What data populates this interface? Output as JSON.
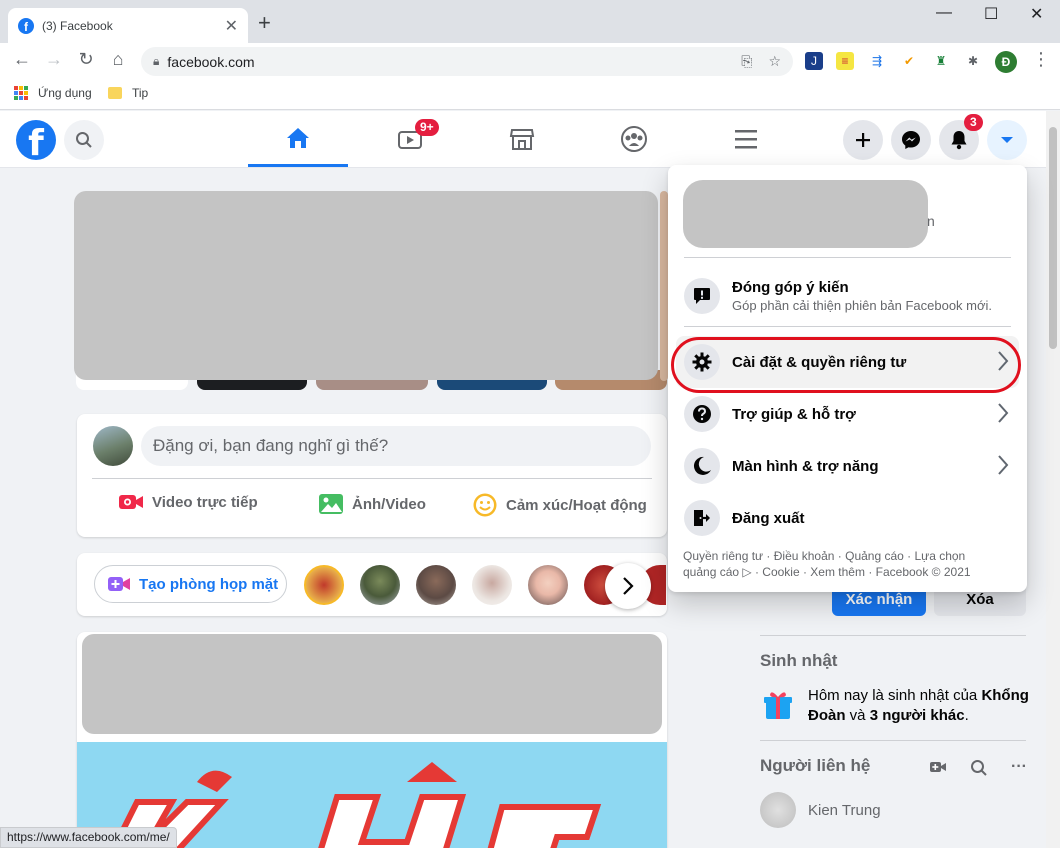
{
  "browser": {
    "tab_title": "(3) Facebook",
    "tab_favicon": "f",
    "url": "facebook.com",
    "profile_initial": "Đ",
    "bookmarks": [
      {
        "label": "Ứng dụng"
      },
      {
        "label": "Tip"
      }
    ],
    "status_url": "https://www.facebook.com/me/"
  },
  "header": {
    "logo_letter": "f",
    "watch_badge": "9+",
    "notifications_badge": "3"
  },
  "composer": {
    "placeholder": "Đặng ơi, bạn đang nghĩ gì thế?",
    "actions": [
      {
        "label": "Video trực tiếp",
        "icon": "live-video-icon",
        "color": "#f02849"
      },
      {
        "label": "Ảnh/Video",
        "icon": "photo-icon",
        "color": "#45bd62"
      },
      {
        "label": "Cảm xúc/Hoạt động",
        "icon": "feeling-icon",
        "color": "#f7b928"
      }
    ]
  },
  "rooms": {
    "create_label": "Tạo phòng họp mặt"
  },
  "right_column": {
    "confirm_label": "Xác nhận",
    "delete_label": "Xóa",
    "birthday_title": "Sinh nhật",
    "birthday_text_pre": "Hôm nay là sinh nhật của ",
    "birthday_name": "Khổng Đoàn",
    "birthday_text_mid": " và ",
    "birthday_others": "3 người khác",
    "birthday_text_end": ".",
    "contacts_title": "Người liên hệ",
    "contacts": [
      {
        "name": "Kien Trung"
      }
    ]
  },
  "menu": {
    "profile_tail": "n",
    "feedback": {
      "label": "Đóng góp ý kiến",
      "sub": "Góp phần cải thiện phiên bản Facebook mới."
    },
    "items": [
      {
        "label": "Cài đặt & quyền riêng tư",
        "icon": "gear-icon"
      },
      {
        "label": "Trợ giúp & hỗ trợ",
        "icon": "question-icon"
      },
      {
        "label": "Màn hình & trợ năng",
        "icon": "moon-icon"
      },
      {
        "label": "Đăng xuất",
        "icon": "logout-icon"
      }
    ],
    "footer_line1": "Quyền riêng tư · Điều khoản · Quảng cáo · Lựa chọn",
    "footer_line2": "quảng cáo ▷ · Cookie · Xem thêm · Facebook © 2021"
  },
  "colors": {
    "brand": "#1877f2",
    "badge": "#e41e3f",
    "highlight_ring": "#e0101e"
  }
}
